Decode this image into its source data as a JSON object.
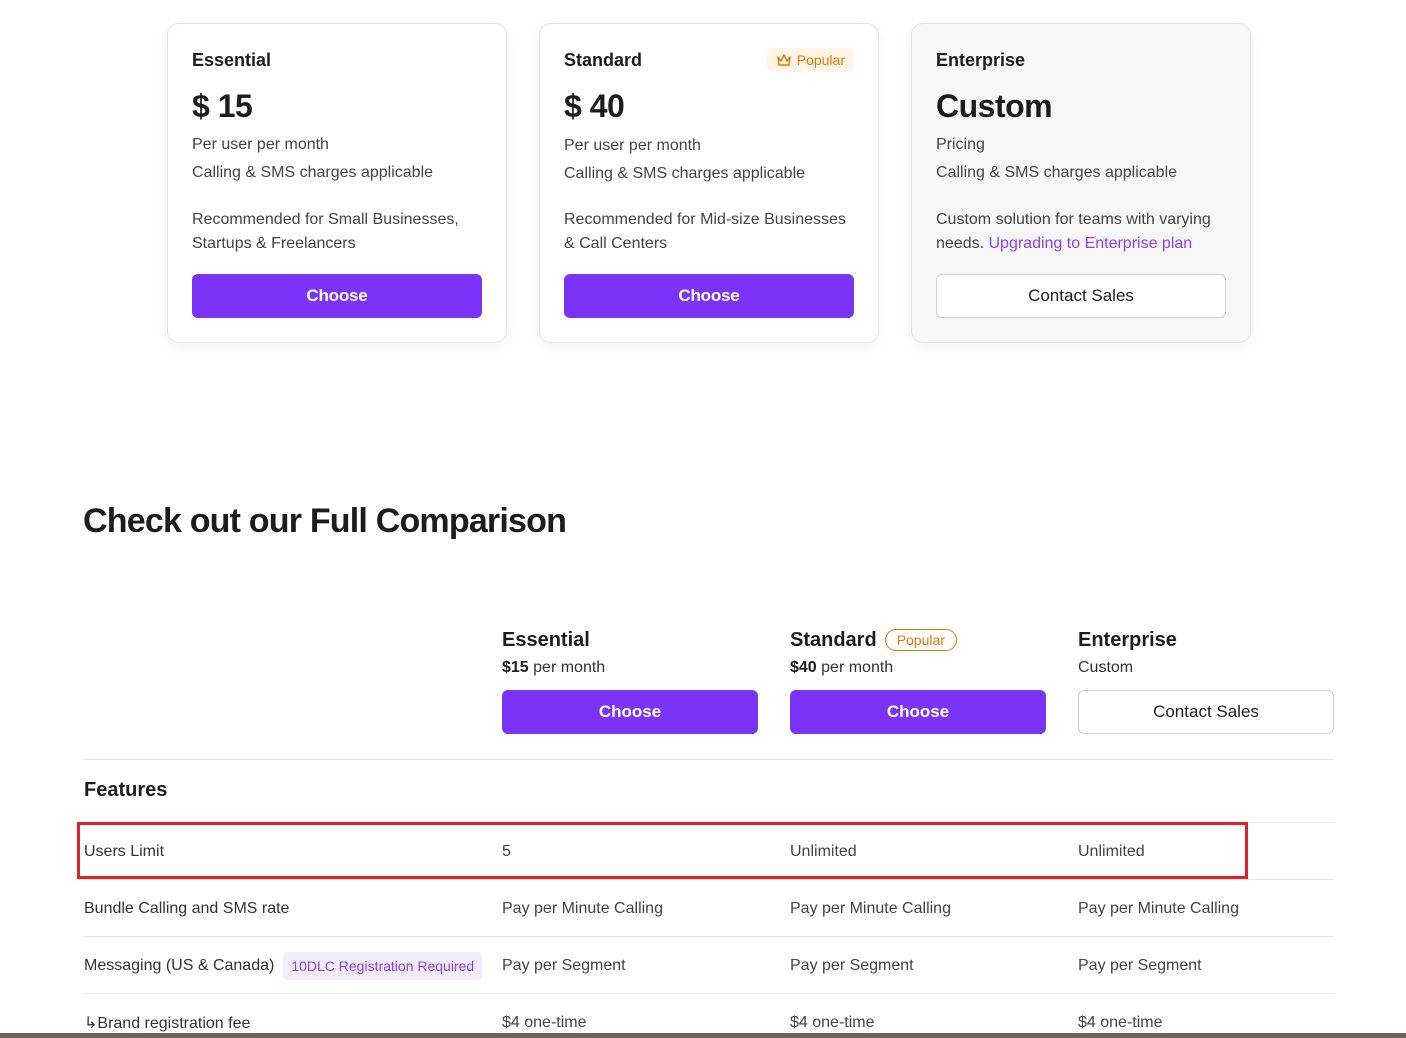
{
  "plans": [
    {
      "name": "Essential",
      "price": "$ 15",
      "line1": "Per user per month",
      "line2": "Calling & SMS charges applicable",
      "recommendation": "Recommended for Small Businesses, Startups & Freelancers",
      "button": "Choose"
    },
    {
      "name": "Standard",
      "badge": "Popular",
      "price": "$ 40",
      "line1": "Per user per month",
      "line2": "Calling & SMS charges applicable",
      "recommendation": "Recommended for Mid-size Businesses & Call Centers",
      "button": "Choose"
    },
    {
      "name": "Enterprise",
      "price": "Custom",
      "line1": "Pricing",
      "line2": "Calling & SMS charges applicable",
      "recommendation": "Custom solution for teams with varying needs.",
      "link": "Upgrading to Enterprise plan",
      "button": "Contact Sales"
    }
  ],
  "comparison": {
    "title": "Check out our Full Comparison",
    "columns": [
      {
        "name": "Essential",
        "price_bold": "$15",
        "price_rest": " per month",
        "button": "Choose"
      },
      {
        "name": "Standard",
        "badge": "Popular",
        "price_bold": "$40",
        "price_rest": " per month",
        "button": "Choose"
      },
      {
        "name": "Enterprise",
        "price_bold": "",
        "price_rest": "Custom",
        "button": "Contact Sales"
      }
    ],
    "features_title": "Features",
    "rows": [
      {
        "feature": "Users Limit",
        "values": [
          "5",
          "Unlimited",
          "Unlimited"
        ]
      },
      {
        "feature": "Bundle Calling and SMS rate",
        "values": [
          "Pay per Minute Calling",
          "Pay per Minute Calling",
          "Pay per Minute Calling"
        ]
      },
      {
        "feature": "Messaging (US & Canada)",
        "badge": "10DLC Registration Required",
        "values": [
          "Pay per Segment",
          "Pay per Segment",
          "Pay per Segment"
        ]
      },
      {
        "feature": "↳Brand registration fee",
        "values": [
          "$4 one-time",
          "$4 one-time",
          "$4 one-time"
        ]
      }
    ]
  },
  "colors": {
    "accent": "#7b33f7",
    "popular": "#e07b00",
    "link": "#8a3ffc",
    "highlight": "#e0202a"
  }
}
